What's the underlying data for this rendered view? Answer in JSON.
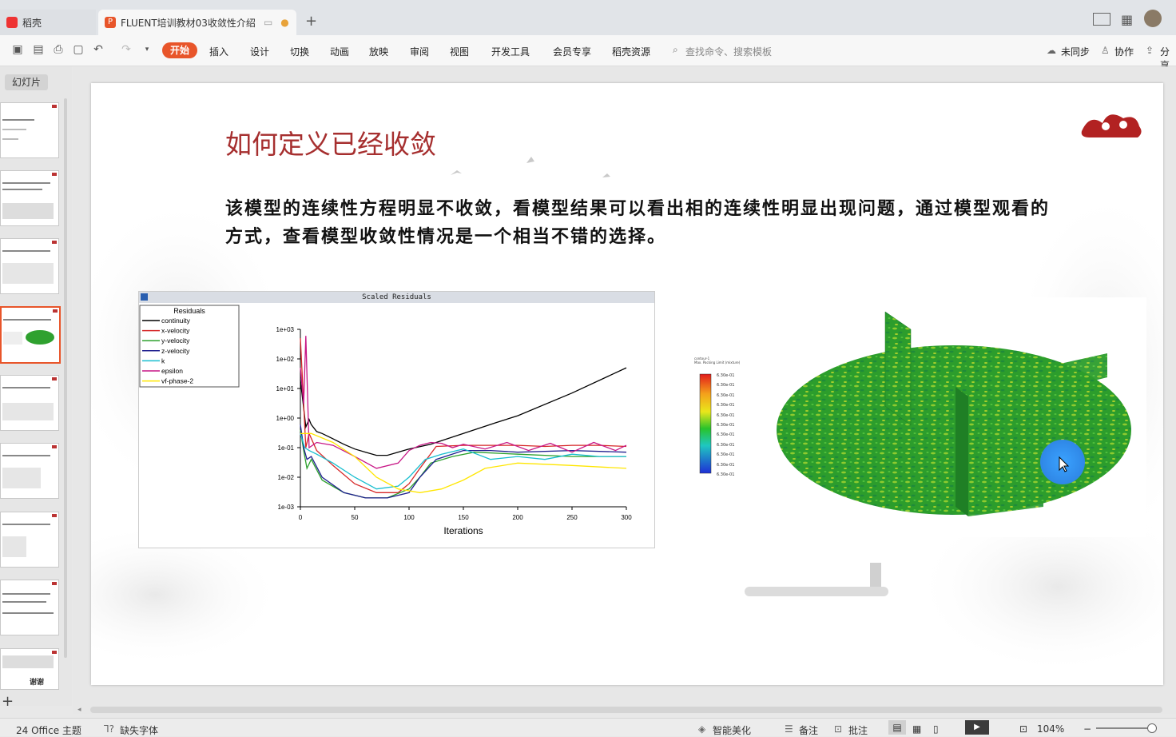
{
  "tabs": {
    "home_label": "稻壳",
    "doc_label": "FLUENT培训教材03收敛性介绍",
    "new_tab": "+"
  },
  "menubar": {
    "items": [
      "开始",
      "插入",
      "设计",
      "切换",
      "动画",
      "放映",
      "审阅",
      "视图",
      "开发工具",
      "会员专享",
      "稻壳资源"
    ],
    "search_placeholder": "查找命令、搜索模板",
    "right": {
      "sync": "未同步",
      "collab": "协作",
      "share": "分享"
    }
  },
  "leftpane": {
    "slides_tab": "幻灯片",
    "thumb_last_label": "谢谢",
    "add": "+"
  },
  "slide": {
    "title": "如何定义已经收敛",
    "body": "该模型的连续性方程明显不收敛，看模型结果可以看出相的连续性明显出现问题，通过模型观看的方式，查看模型收敛性情况是一个相当不错的选择。",
    "contour": {
      "legend_title_1": "contour-1",
      "legend_title_2": "Max. Packing Limit (mixture)",
      "legend_values": [
        "6.30e-01",
        "6.30e-01",
        "6.30e-01",
        "6.30e-01",
        "6.30e-01",
        "6.30e-01",
        "6.30e-01",
        "6.30e-01",
        "6.30e-01",
        "6.30e-01",
        "6.30e-01"
      ]
    }
  },
  "chart_data": {
    "type": "line",
    "title": "Scaled Residuals",
    "xlabel": "Iterations",
    "ylabel": "",
    "xlim": [
      0,
      300
    ],
    "ylim_log10": [
      -3,
      3
    ],
    "yscale": "log",
    "x_ticks": [
      "0",
      "50",
      "100",
      "150",
      "200",
      "250",
      "300"
    ],
    "y_ticks": [
      "1e+03",
      "1e+02",
      "1e+01",
      "1e+00",
      "1e-01",
      "1e-02",
      "1e-03"
    ],
    "legend_title": "Residuals",
    "legend_position": "top-left",
    "series": [
      {
        "name": "continuity",
        "color": "#000000",
        "x": [
          0,
          5,
          8,
          10,
          15,
          20,
          30,
          40,
          50,
          60,
          70,
          80,
          100,
          120,
          150,
          180,
          200,
          250,
          300
        ],
        "y": [
          20,
          0.5,
          0.9,
          0.6,
          0.35,
          0.3,
          0.2,
          0.13,
          0.09,
          0.07,
          0.055,
          0.055,
          0.09,
          0.13,
          0.3,
          0.7,
          1.2,
          7,
          50
        ]
      },
      {
        "name": "x-velocity",
        "color": "#d62728",
        "x": [
          0,
          5,
          8,
          15,
          30,
          50,
          70,
          90,
          100,
          110,
          125,
          150,
          175,
          200,
          225,
          250,
          275,
          300
        ],
        "y": [
          500,
          0.1,
          0.3,
          0.08,
          0.025,
          0.006,
          0.003,
          0.003,
          0.006,
          0.02,
          0.11,
          0.12,
          0.12,
          0.12,
          0.11,
          0.12,
          0.12,
          0.11
        ]
      },
      {
        "name": "y-velocity",
        "color": "#2ca02c",
        "x": [
          0,
          3,
          6,
          10,
          20,
          40,
          60,
          80,
          100,
          110,
          120,
          140,
          160,
          200,
          250,
          300
        ],
        "y": [
          0.4,
          0.08,
          0.02,
          0.04,
          0.008,
          0.003,
          0.002,
          0.002,
          0.004,
          0.01,
          0.03,
          0.05,
          0.07,
          0.06,
          0.05,
          0.05
        ]
      },
      {
        "name": "z-velocity",
        "color": "#1f1f8f",
        "x": [
          0,
          3,
          6,
          10,
          20,
          40,
          60,
          80,
          100,
          110,
          125,
          150,
          175,
          200,
          250,
          300
        ],
        "y": [
          0.6,
          0.1,
          0.04,
          0.05,
          0.01,
          0.003,
          0.002,
          0.002,
          0.003,
          0.01,
          0.04,
          0.08,
          0.08,
          0.07,
          0.08,
          0.07
        ]
      },
      {
        "name": "k",
        "color": "#17becf",
        "x": [
          0,
          4,
          8,
          15,
          30,
          50,
          70,
          90,
          100,
          115,
          130,
          150,
          175,
          200,
          225,
          250,
          275,
          300
        ],
        "y": [
          0.3,
          0.1,
          0.08,
          0.06,
          0.03,
          0.01,
          0.004,
          0.005,
          0.01,
          0.04,
          0.06,
          0.09,
          0.04,
          0.05,
          0.04,
          0.06,
          0.05,
          0.05
        ]
      },
      {
        "name": "epsilon",
        "color": "#c71585",
        "x": [
          0,
          3,
          5,
          8,
          15,
          30,
          50,
          70,
          90,
          100,
          110,
          120,
          130,
          140,
          150,
          170,
          190,
          210,
          230,
          250,
          270,
          290,
          300
        ],
        "y": [
          50,
          3,
          600,
          0.1,
          0.15,
          0.12,
          0.05,
          0.02,
          0.03,
          0.08,
          0.12,
          0.15,
          0.14,
          0.1,
          0.13,
          0.09,
          0.15,
          0.08,
          0.14,
          0.07,
          0.15,
          0.08,
          0.12
        ]
      },
      {
        "name": "vf-phase-2",
        "color": "#ffe600",
        "x": [
          0,
          10,
          30,
          50,
          70,
          90,
          110,
          130,
          150,
          170,
          200,
          250,
          300
        ],
        "y": [
          0.3,
          0.3,
          0.15,
          0.05,
          0.01,
          0.004,
          0.003,
          0.004,
          0.008,
          0.02,
          0.03,
          0.025,
          0.02
        ]
      }
    ]
  },
  "scrollbar": {
    "arrow": "◂"
  },
  "statusbar": {
    "theme": "24 Office 主题",
    "missing_font": "缺失字体",
    "beautify": "智能美化",
    "notes": "备注",
    "comments": "批注",
    "zoom": "104%"
  }
}
